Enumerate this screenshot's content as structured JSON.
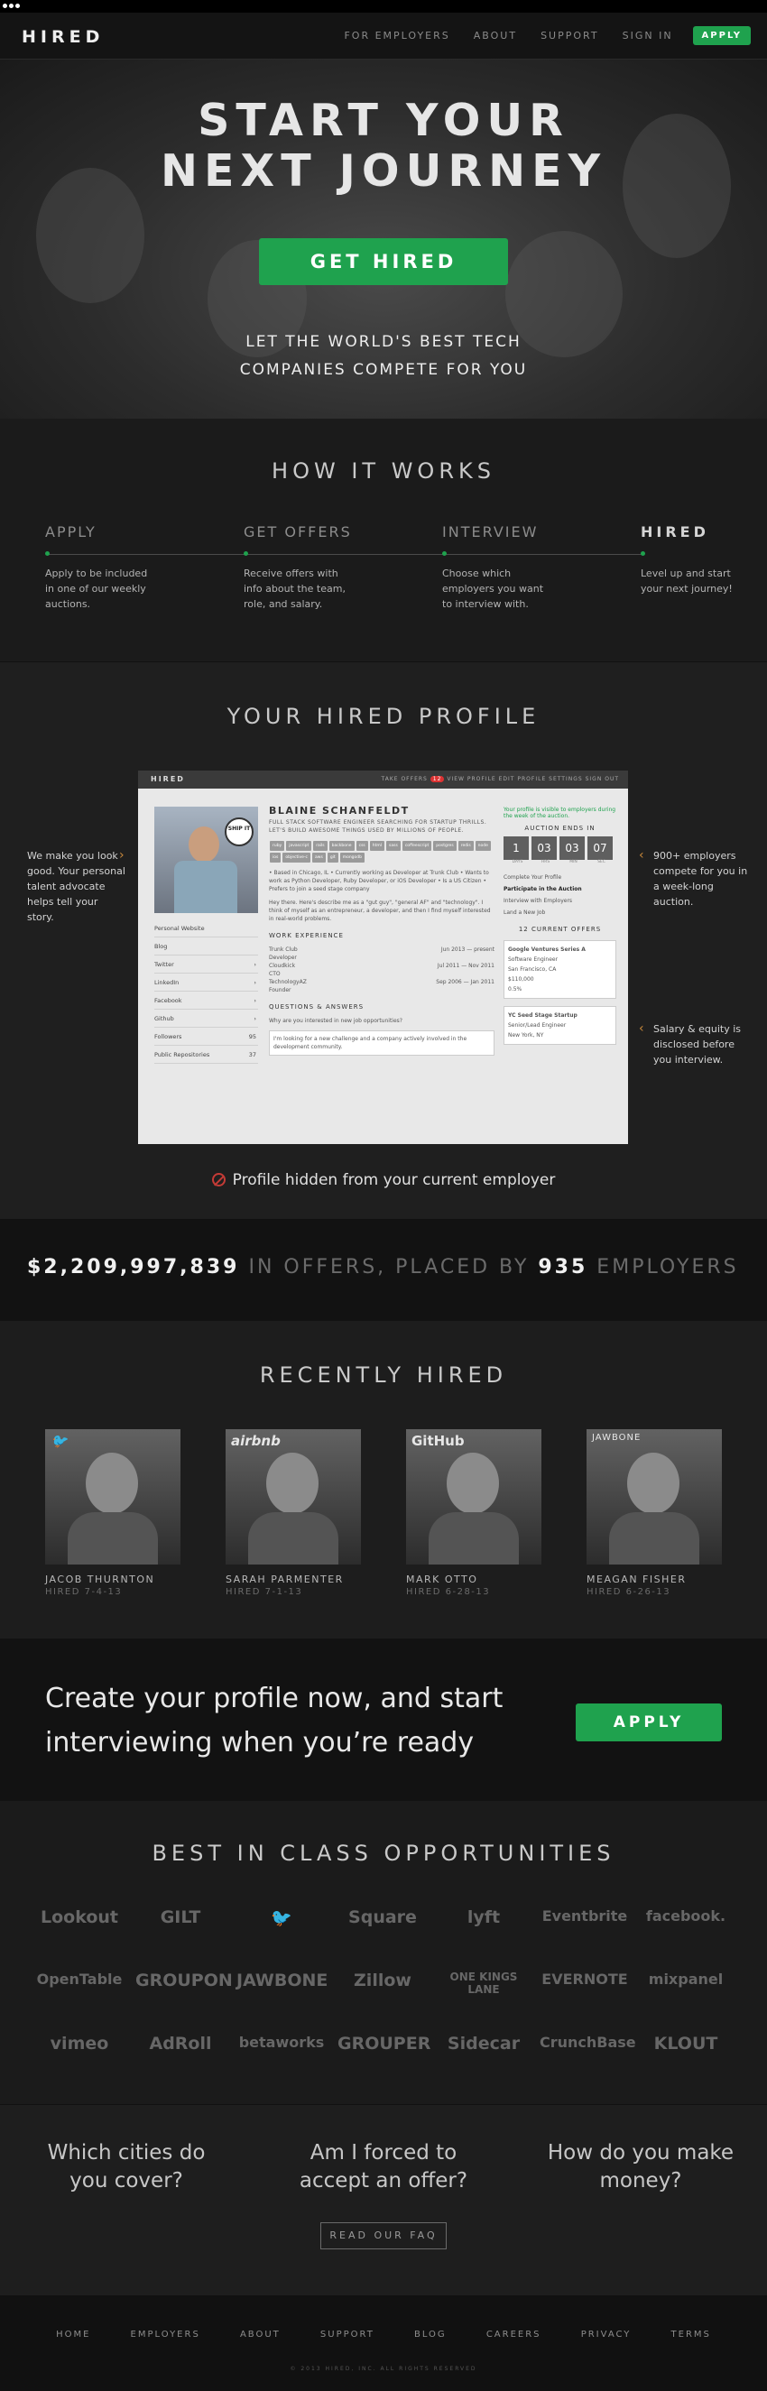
{
  "nav": {
    "logo": "HIRED",
    "links": [
      "FOR EMPLOYERS",
      "ABOUT",
      "SUPPORT",
      "SIGN IN"
    ],
    "apply": "APPLY"
  },
  "hero": {
    "title_line1": "START YOUR",
    "title_line2": "NEXT JOURNEY",
    "button": "GET HIRED",
    "sub_line1": "LET THE WORLD'S BEST TECH",
    "sub_line2": "COMPANIES COMPETE FOR YOU"
  },
  "how": {
    "title": "HOW IT WORKS",
    "steps": [
      {
        "label": "APPLY",
        "desc": "Apply to be included in one of our weekly auctions."
      },
      {
        "label": "GET OFFERS",
        "desc": "Receive offers with info about the team, role, and salary."
      },
      {
        "label": "INTERVIEW",
        "desc": "Choose which employers you want to interview with."
      },
      {
        "label": "HIRED",
        "desc": "Level up and start your next journey!"
      }
    ]
  },
  "profile": {
    "title": "YOUR HIRED PROFILE",
    "left_note": "We make you look good. Your personal talent advocate helps tell your story.",
    "right_note1": "900+ employers compete for you in a week-long auction.",
    "right_note2": "Salary & equity is disclosed before you interview.",
    "hidden": "Profile hidden from your current employer",
    "shot": {
      "logo": "HIRED",
      "top_links": "TAKE OFFERS",
      "badge": "12",
      "top_links2": "VIEW PROFILE   EDIT PROFILE   SETTINGS   SIGN OUT",
      "sign": "SHIP IT",
      "side_links": [
        "Personal Website",
        "Blog",
        "Twitter",
        "LinkedIn",
        "Facebook",
        "Github",
        "Followers",
        "Public Repositories"
      ],
      "side_counts": [
        "",
        "",
        "›",
        "›",
        "›",
        "›",
        "95",
        "37"
      ],
      "name": "BLAINE SCHANFELDT",
      "tagline": "FULL STACK SOFTWARE ENGINEER SEARCHING FOR STARTUP THRILLS. LET'S BUILD AWESOME THINGS USED BY MILLIONS OF PEOPLE.",
      "chips": [
        "ruby",
        "javascript",
        "rails",
        "backbone",
        "css",
        "html",
        "sass",
        "coffeescript",
        "postgres",
        "redis",
        "node",
        "ios",
        "objective-c",
        "aws",
        "git",
        "mongodb"
      ],
      "bullets": "• Based in Chicago, IL • Currently working as Developer at Trunk Club • Wants to work as Python Developer, Ruby Developer, or iOS Developer • Is a US Citizen • Prefers to join a seed stage company",
      "about": "Hey there. Here's describe me as a \"gut guy\", \"general AF\" and \"technology\". I think of myself as an entrepreneur, a developer, and then I find myself interested in real-world problems.",
      "work_title": "WORK EXPERIENCE",
      "jobs": [
        {
          "company": "Trunk Club",
          "role": "Developer",
          "dates": "Jun 2013 — present"
        },
        {
          "company": "Cloudkick",
          "role": "CTO",
          "dates": "Jul 2011 — Nov 2011"
        },
        {
          "company": "TechnologyAZ",
          "role": "Founder",
          "dates": "Sep 2006 — Jan 2011"
        }
      ],
      "qa_title": "QUESTIONS & ANSWERS",
      "qa_q": "Why are you interested in new job opportunities?",
      "qa_a": "I'm looking for a new challenge and a company actively involved in the development community.",
      "visible": "Your profile is visible to employers during the week of the auction.",
      "auction": "AUCTION ENDS IN",
      "countdown": [
        "1",
        "03",
        "03",
        "07"
      ],
      "countdown_labels": [
        "DAYS",
        "HRS",
        "MIN",
        "SEC"
      ],
      "steps": [
        "Complete Your Profile",
        "Participate in the Auction",
        "Interview with Employers",
        "Land a New Job"
      ],
      "current_offers": "12 CURRENT OFFERS",
      "offer1": {
        "company": "Google Ventures Series A",
        "title": "Software Engineer",
        "location": "San Francisco, CA",
        "salary": "$110,000",
        "equity": "0.5%"
      },
      "offer2": {
        "company": "YC Seed Stage Startup",
        "title": "Senior/Lead Engineer",
        "location": "New York, NY"
      }
    }
  },
  "stat": {
    "amount": "$2,209,997,839",
    "middle": " IN OFFERS, PLACED BY ",
    "count": "935",
    "end": " EMPLOYERS"
  },
  "recent": {
    "title": "RECENTLY HIRED",
    "people": [
      {
        "name": "JACOB THURNTON",
        "date": "HIRED 7-4-13",
        "brand": "🐦"
      },
      {
        "name": "SARAH PARMENTER",
        "date": "HIRED 7-1-13",
        "brand": "airbnb"
      },
      {
        "name": "MARK OTTO",
        "date": "HIRED 6-28-13",
        "brand": "GitHub"
      },
      {
        "name": "MEAGAN FISHER",
        "date": "HIRED 6-26-13",
        "brand": "JAWBONE"
      }
    ]
  },
  "cta": {
    "text": "Create your profile now, and start interviewing when you’re ready",
    "button": "APPLY"
  },
  "logos": {
    "title": "BEST IN CLASS OPPORTUNITIES",
    "items": [
      "Lookout",
      "GILT",
      "🐦",
      "Square",
      "lyft",
      "Eventbrite",
      "facebook.",
      "OpenTable",
      "GROUPON",
      "JAWBONE",
      "Zillow",
      "ONE KINGS LANE",
      "EVERNOTE",
      "mixpanel",
      "vimeo",
      "AdRoll",
      "betaworks",
      "GROUPER",
      "Sidecar",
      "CrunchBase",
      "KLOUT"
    ]
  },
  "faq": {
    "q1": "Which cities do you cover?",
    "q2": "Am I forced to accept an offer?",
    "q3": "How do you make money?",
    "button": "READ OUR FAQ"
  },
  "footer": {
    "links": [
      "HOME",
      "EMPLOYERS",
      "ABOUT",
      "SUPPORT",
      "BLOG",
      "CAREERS",
      "PRIVACY",
      "TERMS"
    ],
    "copyright": "© 2013 HIRED, INC. ALL RIGHTS RESERVED"
  }
}
